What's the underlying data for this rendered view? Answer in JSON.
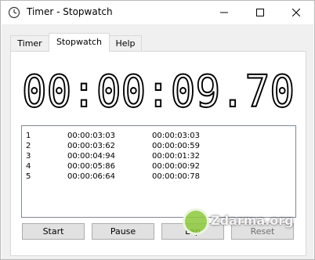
{
  "window": {
    "title": "Timer - Stopwatch"
  },
  "tabs": [
    {
      "label": "Timer"
    },
    {
      "label": "Stopwatch",
      "active": true
    },
    {
      "label": "Help"
    }
  ],
  "stopwatch": {
    "display": "00:00:09.70",
    "laps": [
      {
        "num": "1",
        "total": "00:00:03:03",
        "split": "00:00:03:03"
      },
      {
        "num": "2",
        "total": "00:00:03:62",
        "split": "00:00:00:59"
      },
      {
        "num": "3",
        "total": "00:00:04:94",
        "split": "00:00:01:32"
      },
      {
        "num": "4",
        "total": "00:00:05:86",
        "split": "00:00:00:92"
      },
      {
        "num": "5",
        "total": "00:00:06:64",
        "split": "00:00:00:78"
      }
    ],
    "buttons": {
      "start": "Start",
      "pause": "Pause",
      "lap": "Lap",
      "reset": "Reset"
    }
  },
  "watermark": {
    "text": "Zdarma.org"
  },
  "colors": {
    "window_bg": "#f0f0f0",
    "panel_bg": "#ffffff",
    "button_bg": "#e1e1e1",
    "watermark_green": "#8cc83c"
  },
  "icons": [
    "app-icon",
    "minimize-icon",
    "maximize-icon",
    "close-icon"
  ]
}
